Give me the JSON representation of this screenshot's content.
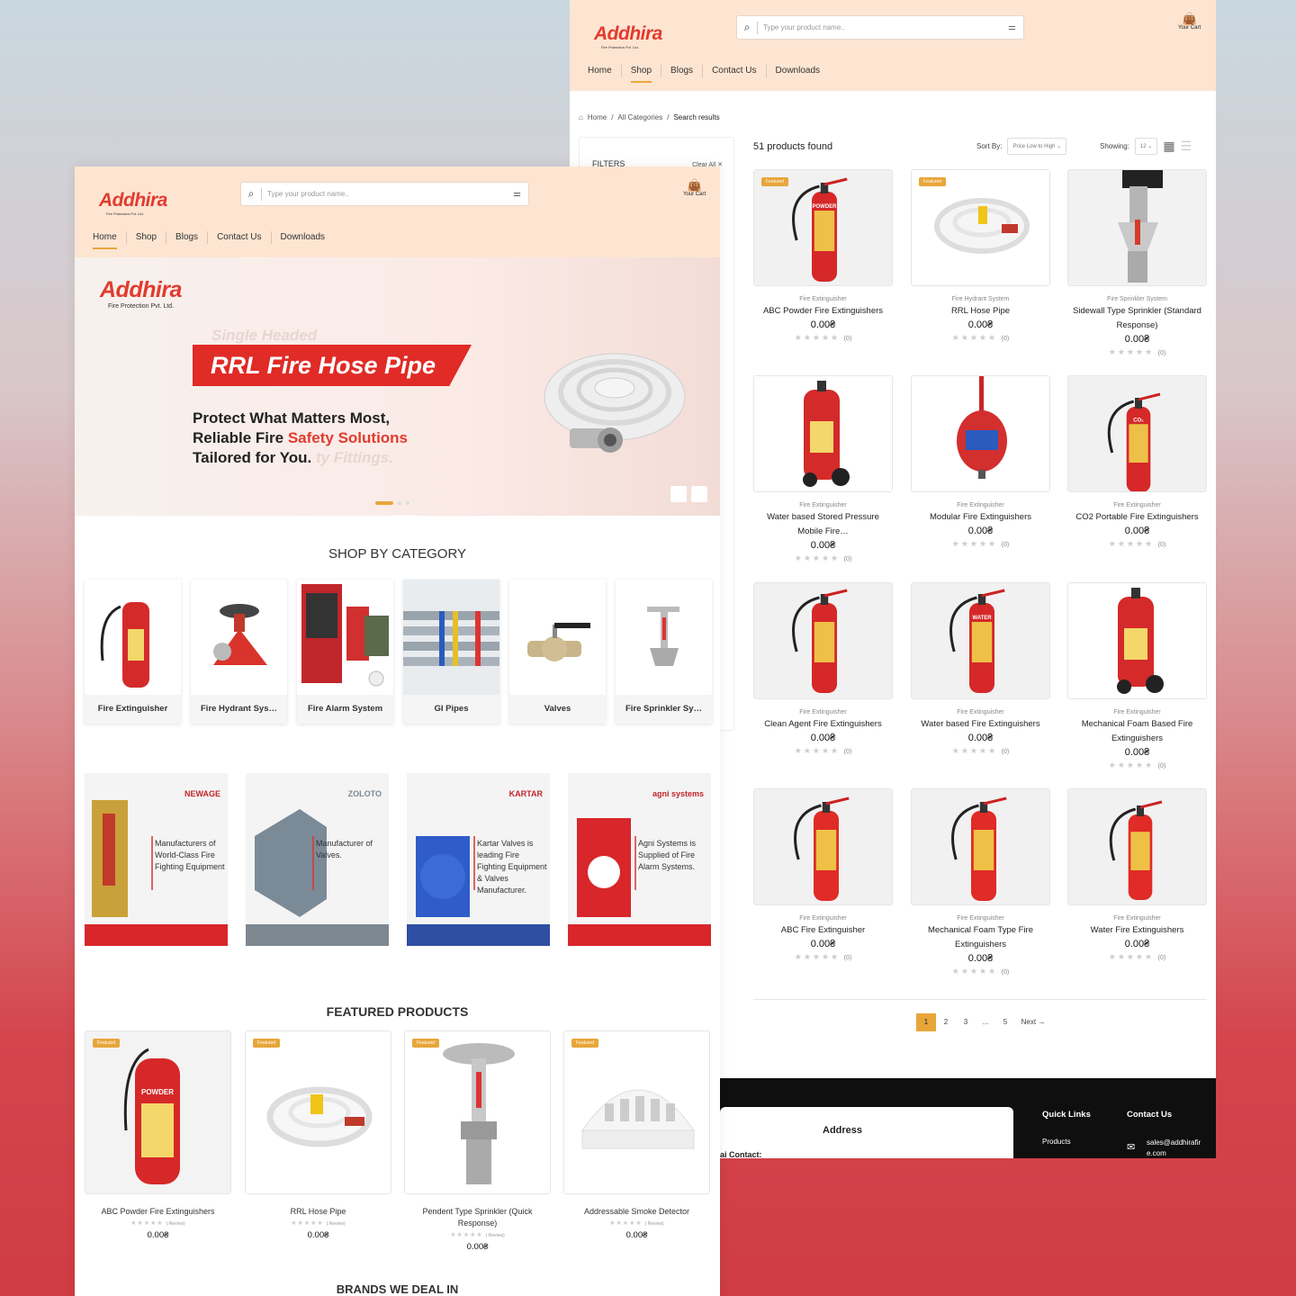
{
  "brand": {
    "name": "Addhira",
    "subtitle": "Fire Protection Pvt. Ltd."
  },
  "search": {
    "placeholder": "Type your product name.."
  },
  "cart": {
    "label": "Your Cart"
  },
  "nav": [
    "Home",
    "Shop",
    "Blogs",
    "Contact Us",
    "Downloads"
  ],
  "breadcrumb": {
    "home": "Home",
    "sep": "/",
    "categories": "All Categories",
    "current": "Search results"
  },
  "filters": {
    "title": "FILTERS",
    "clear": "Clear All ✕"
  },
  "results": {
    "count": "51 products found",
    "sort_label": "Sort By:",
    "sort_value": "Price Low to High",
    "showing_label": "Showing:",
    "showing_value": "12"
  },
  "products": [
    {
      "category": "Fire Extinguisher",
      "name": "ABC Powder Fire Extinguishers",
      "price": "0.00₴",
      "reviews": "(0)",
      "featured": true
    },
    {
      "category": "Fire Hydrant System",
      "name": "RRL Hose Pipe",
      "price": "0.00₴",
      "reviews": "(0)",
      "featured": true
    },
    {
      "category": "Fire Sprinkler System",
      "name": "Sidewall Type Sprinkler (Standard Response)",
      "price": "0.00₴",
      "reviews": "(0)",
      "featured": false
    },
    {
      "category": "Fire Extinguisher",
      "name": "Water based Stored Pressure Mobile Fire…",
      "price": "0.00₴",
      "reviews": "(0)",
      "featured": false
    },
    {
      "category": "Fire Extinguisher",
      "name": "Modular Fire Extinguishers",
      "price": "0.00₴",
      "reviews": "(0)",
      "featured": false
    },
    {
      "category": "Fire Extinguisher",
      "name": "CO2 Portable Fire Extinguishers",
      "price": "0.00₴",
      "reviews": "(0)",
      "featured": false
    },
    {
      "category": "Fire Extinguisher",
      "name": "Clean Agent Fire Extinguishers",
      "price": "0.00₴",
      "reviews": "(0)",
      "featured": false
    },
    {
      "category": "Fire Extinguisher",
      "name": "Water based Fire Extinguishers",
      "price": "0.00₴",
      "reviews": "(0)",
      "featured": false
    },
    {
      "category": "Fire Extinguisher",
      "name": "Mechanical Foam Based Fire Extinguishers",
      "price": "0.00₴",
      "reviews": "(0)",
      "featured": false
    },
    {
      "category": "Fire Extinguisher",
      "name": "ABC Fire Extinguisher",
      "price": "0.00₴",
      "reviews": "(0)",
      "featured": false
    },
    {
      "category": "Fire Extinguisher",
      "name": "Mechanical Foam Type Fire Extinguishers",
      "price": "0.00₴",
      "reviews": "(0)",
      "featured": false
    },
    {
      "category": "Fire Extinguisher",
      "name": "Water Fire Extinguishers",
      "price": "0.00₴",
      "reviews": "(0)",
      "featured": false
    }
  ],
  "pagination": [
    "1",
    "2",
    "3",
    "...",
    "5",
    "Next →"
  ],
  "footer": {
    "address": "Address",
    "contact_partial": "ai Contact:",
    "quick_links": "Quick Links",
    "contact_us": "Contact Us",
    "products": "Products",
    "email": "sales@addhirafire.com"
  },
  "hero": {
    "ghost_top": "Single Headed",
    "title": "RRL Fire Hose Pipe",
    "line1": "Protect What Matters Most,",
    "line2a": "Reliable Fire ",
    "line2b": "Safety Solutions",
    "line3": "Tailored for You.",
    "ghost_bottom": "ty Fittings."
  },
  "categories_title": "SHOP BY CATEGORY",
  "categories": [
    "Fire Extinguisher",
    "Fire Hydrant Sys…",
    "Fire Alarm System",
    "GI Pipes",
    "Valves",
    "Fire Sprinkler Sy…"
  ],
  "brands": [
    {
      "logo": "NEWAGE",
      "text": "Manufacturers of World-Class Fire Fighting Equipment"
    },
    {
      "logo": "ZOLOTO",
      "text": "Manufacturer of Valves."
    },
    {
      "logo": "KARTAR",
      "text": "Kartar Valves is leading Fire Fighting Equipment & Valves Manufacturer."
    },
    {
      "logo": "agni systems",
      "text": "Agni Systems is Supplied of Fire Alarm Systems."
    }
  ],
  "featured_title": "FEATURED PRODUCTS",
  "featured_badge": "Featured",
  "featured": [
    {
      "name": "ABC Powder Fire Extinguishers",
      "review": "( Review)",
      "price": "0.00₴"
    },
    {
      "name": "RRL Hose Pipe",
      "review": "( Review)",
      "price": "0.00₴"
    },
    {
      "name": "Pendent Type Sprinkler (Quick Response)",
      "review": "( Review)",
      "price": "0.00₴"
    },
    {
      "name": "Addressable Smoke Detector",
      "review": "( Review)",
      "price": "0.00₴"
    }
  ],
  "brands_title": "BRANDS WE DEAL IN",
  "stars": "★★★★★",
  "colors": {
    "accent": "#e8a63a",
    "brand_red": "#e23b2e",
    "header_bg": "#fde5d2"
  }
}
